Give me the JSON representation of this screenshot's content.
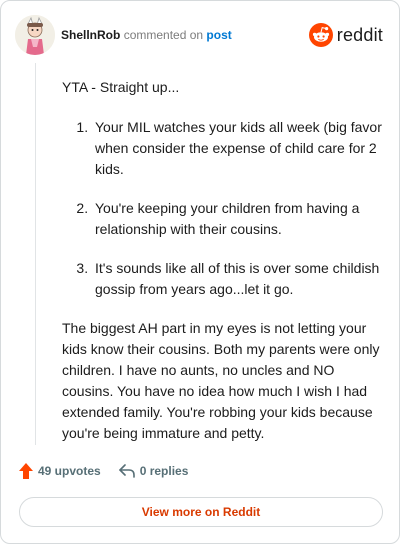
{
  "header": {
    "username": "ShellnRob",
    "verb": "commented on",
    "post_link": "post",
    "logo_text": "reddit"
  },
  "comment": {
    "intro": "YTA - Straight up...",
    "points": [
      "Your MIL watches your kids all week (big favor when consider the expense of child care for 2 kids.",
      "You're keeping your children from having a relationship with their cousins.",
      "It's sounds like all of this is over some childish gossip from years ago...let it go."
    ],
    "closing": "The biggest AH part in my eyes is not letting your kids know their cousins. Both my parents were only children. I have no aunts, no uncles and NO cousins. You have no idea how much I wish I had extended family. You're robbing your kids because you're being immature and petty."
  },
  "actions": {
    "upvotes": "49 upvotes",
    "replies": "0 replies",
    "upvote_icon": "upvote-arrow-icon",
    "reply_icon": "reply-arrow-icon"
  },
  "button": {
    "view_more": "View more on Reddit"
  },
  "colors": {
    "reddit_orange": "#ff4500",
    "link_blue": "#0079d3",
    "button_text": "#d93a00",
    "muted": "#576f76"
  }
}
